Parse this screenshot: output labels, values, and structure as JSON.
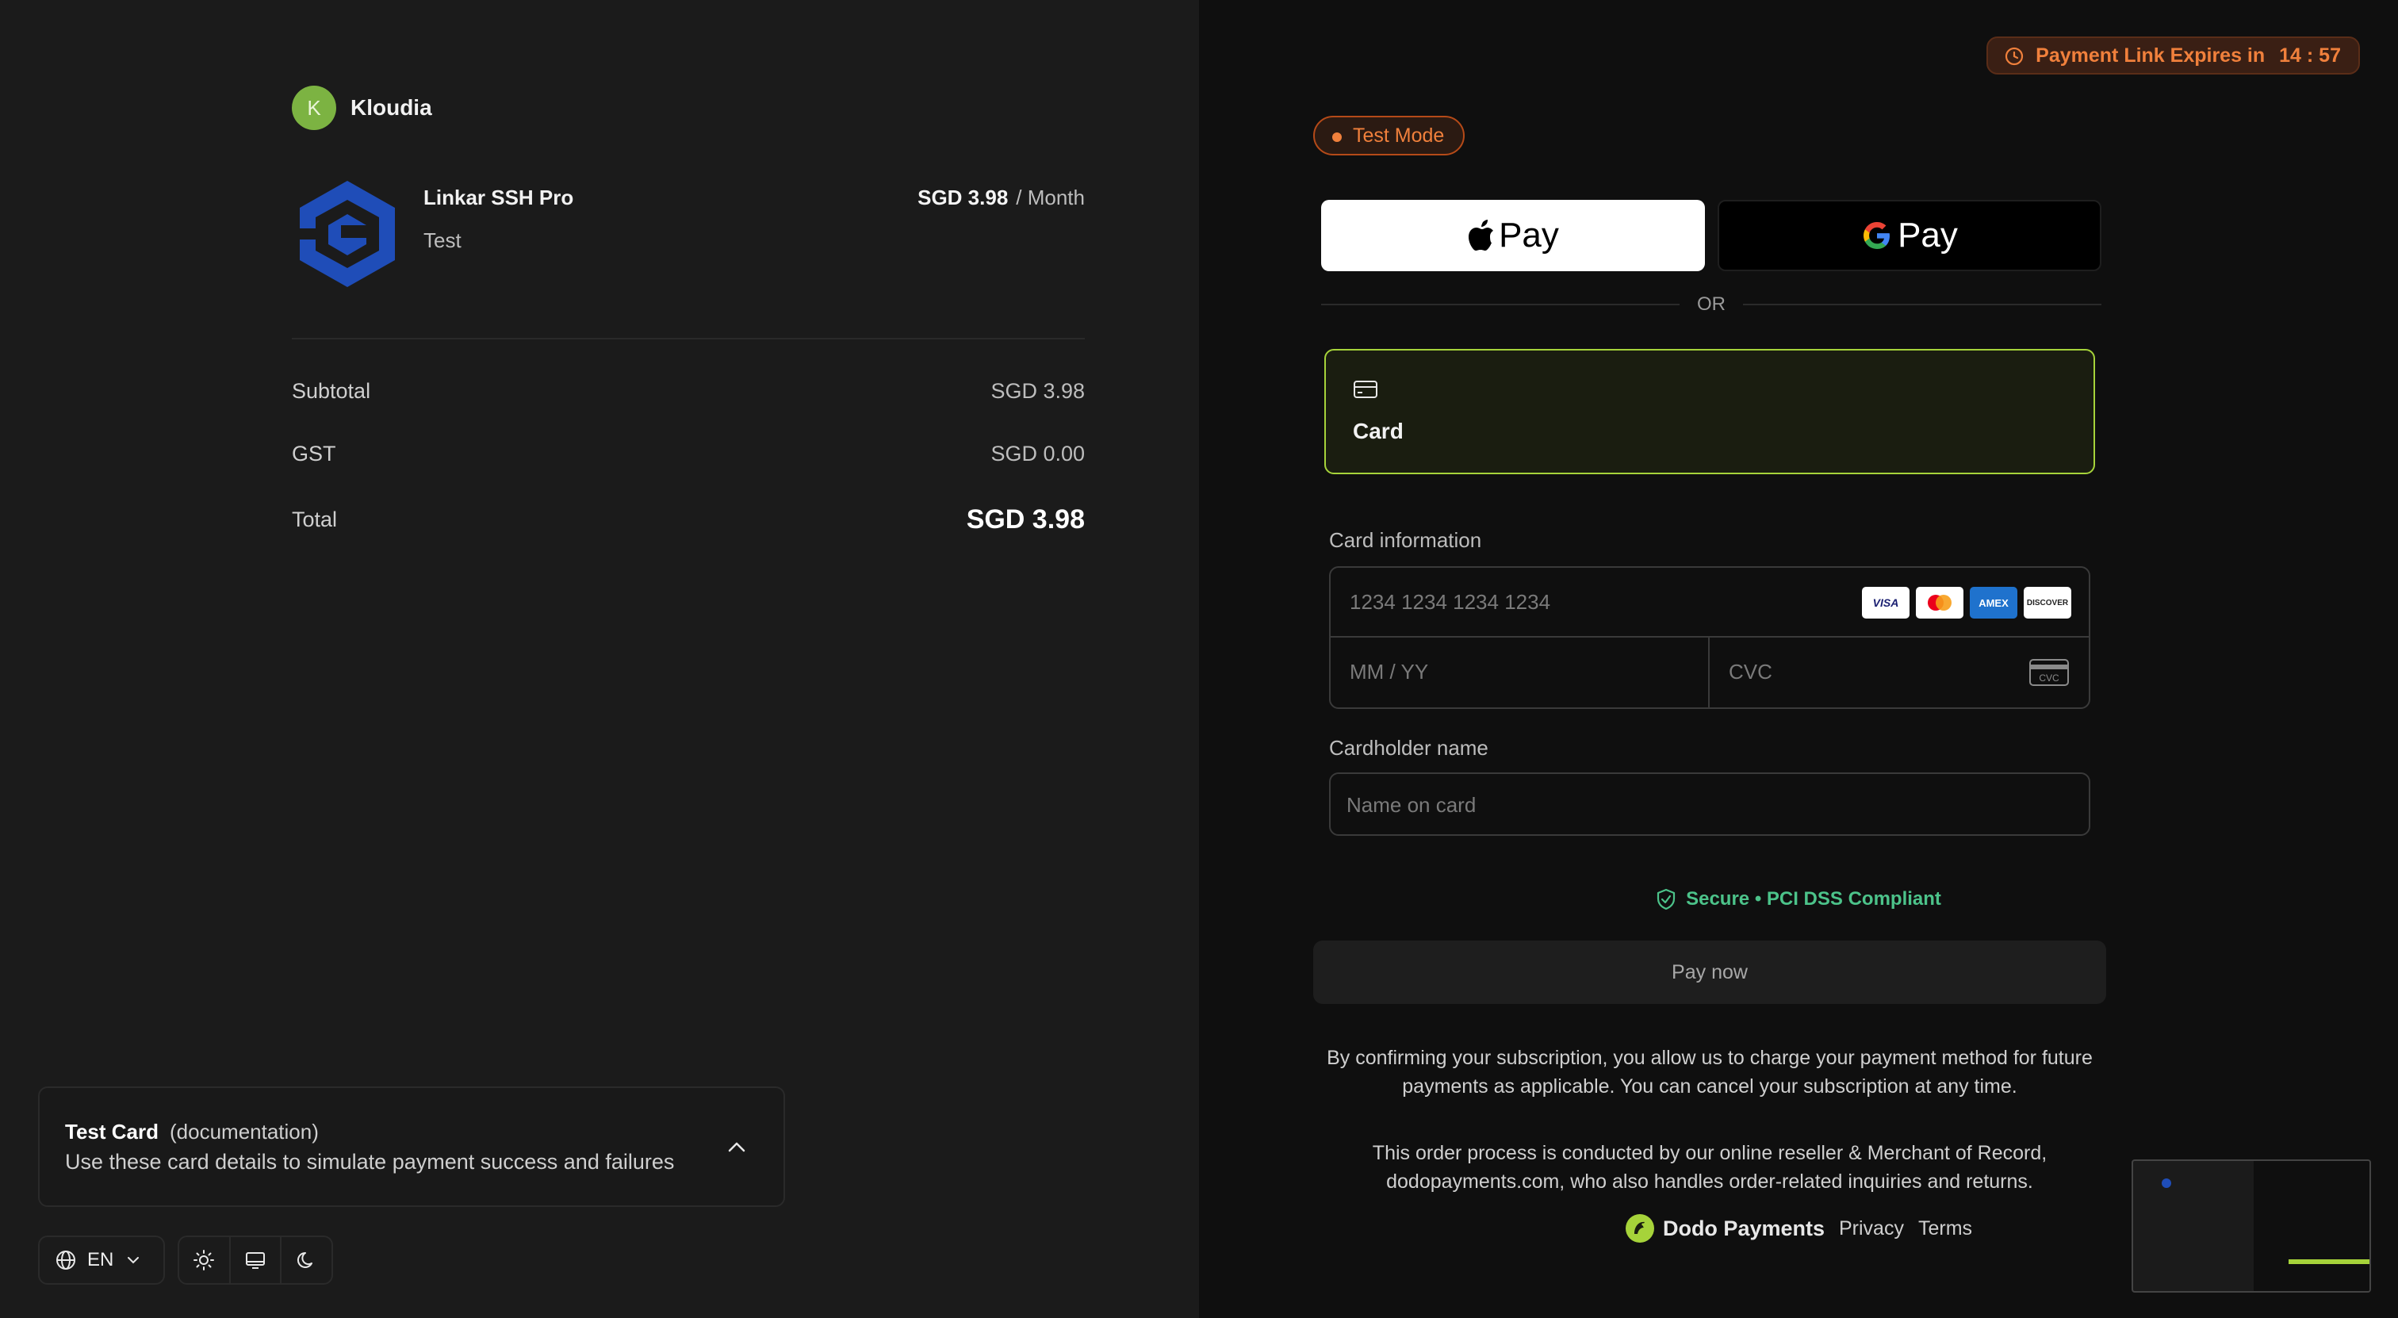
{
  "merchant": {
    "initial": "K",
    "name": "Kloudia"
  },
  "product": {
    "name": "Linkar SSH Pro",
    "description": "Test",
    "price": "SGD 3.98",
    "period": "/ Month"
  },
  "summary": {
    "subtotal_label": "Subtotal",
    "subtotal_value": "SGD 3.98",
    "tax_label": "GST",
    "tax_value": "SGD 0.00",
    "total_label": "Total",
    "total_value": "SGD 3.98"
  },
  "test_card": {
    "title": "Test Card",
    "link": "(documentation)",
    "description": "Use these card details to simulate payment success and failures"
  },
  "language": {
    "code": "EN"
  },
  "expiry": {
    "label": "Payment Link Expires in",
    "time": "14 : 57"
  },
  "test_mode": "Test Mode",
  "wallets": {
    "apple_label": "Pay",
    "google_label": "Pay",
    "or": "OR"
  },
  "method": {
    "card_label": "Card"
  },
  "card_form": {
    "card_info_label": "Card information",
    "number_placeholder": "1234 1234 1234 1234",
    "expiry_placeholder": "MM / YY",
    "cvc_placeholder": "CVC",
    "cardholder_label": "Cardholder name",
    "name_placeholder": "Name on card",
    "brands": [
      "VISA",
      "Mastercard",
      "AMEX",
      "DISCOVER"
    ]
  },
  "secure_text": "Secure • PCI DSS Compliant",
  "pay_button": "Pay now",
  "consent_text": "By confirming your subscription, you allow us to charge your payment method for future payments as applicable. You can cancel your subscription at any time.",
  "mor_text": "This order process is conducted by our online reseller & Merchant of Record, dodopayments.com, who also handles order-related inquiries and returns.",
  "footer": {
    "brand": "Dodo Payments",
    "privacy": "Privacy",
    "terms": "Terms"
  },
  "colors": {
    "accent": "#a6d33a",
    "warning": "#f0803c",
    "success": "#4cc38a"
  }
}
